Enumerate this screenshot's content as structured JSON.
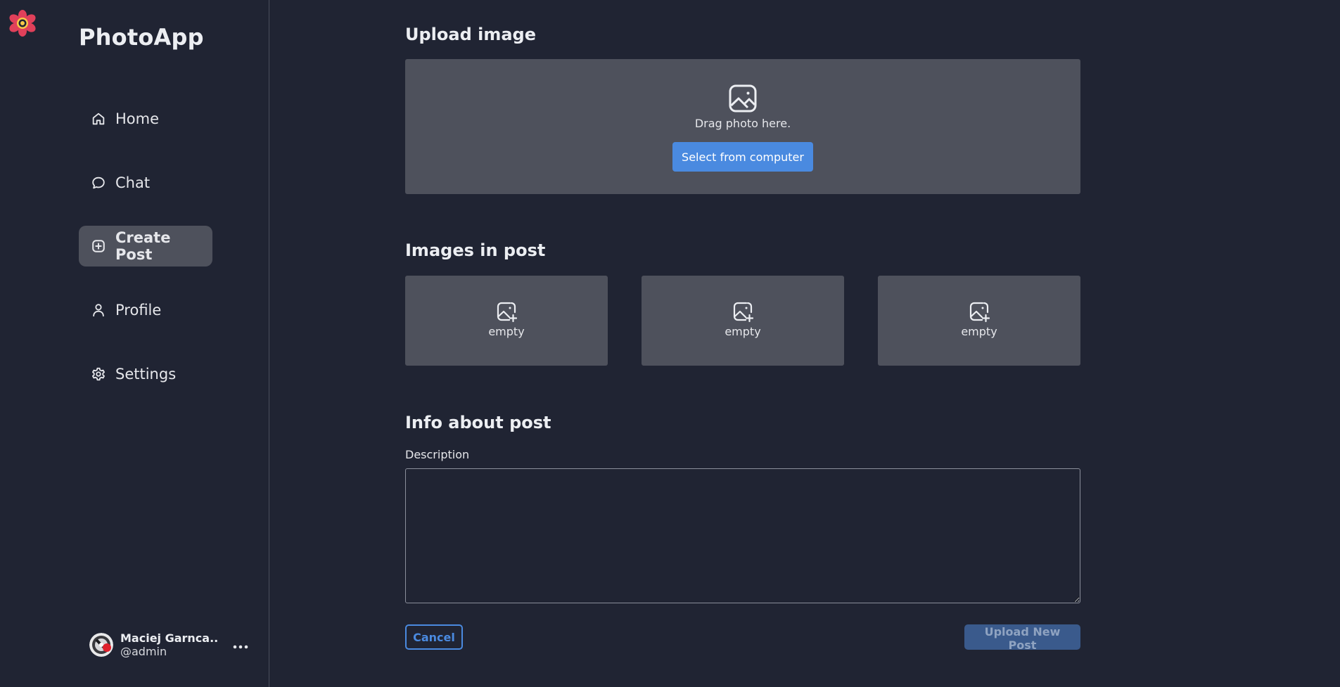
{
  "app": {
    "name": "PhotoApp",
    "logo_icon": "flower-logo-icon"
  },
  "sidebar": {
    "items": [
      {
        "label": "Home",
        "icon": "home-icon",
        "active": false
      },
      {
        "label": "Chat",
        "icon": "chat-bubble-icon",
        "active": false
      },
      {
        "label": "Create Post",
        "icon": "plus-square-icon",
        "active": true
      },
      {
        "label": "Profile",
        "icon": "user-icon",
        "active": false
      },
      {
        "label": "Settings",
        "icon": "gear-icon",
        "active": false
      }
    ]
  },
  "user": {
    "name": "Maciej Garnca...",
    "handle": "@admin",
    "more_icon": "ellipsis-icon"
  },
  "upload": {
    "title": "Upload image",
    "hint": "Drag photo here.",
    "select_button": "Select from computer",
    "icon": "image-icon"
  },
  "images": {
    "title": "Images in post",
    "slots": [
      {
        "label": "empty",
        "icon": "image-add-icon"
      },
      {
        "label": "empty",
        "icon": "image-add-icon"
      },
      {
        "label": "empty",
        "icon": "image-add-icon"
      }
    ]
  },
  "info": {
    "title": "Info about post",
    "description_label": "Description",
    "description_value": ""
  },
  "actions": {
    "cancel": "Cancel",
    "submit": "Upload New Post",
    "submit_disabled": true
  },
  "colors": {
    "background": "#202433",
    "panel": "#4e515c",
    "accent": "#4a8ae0",
    "accent_disabled": "#3a5a8c",
    "logo": "#e0405a"
  }
}
